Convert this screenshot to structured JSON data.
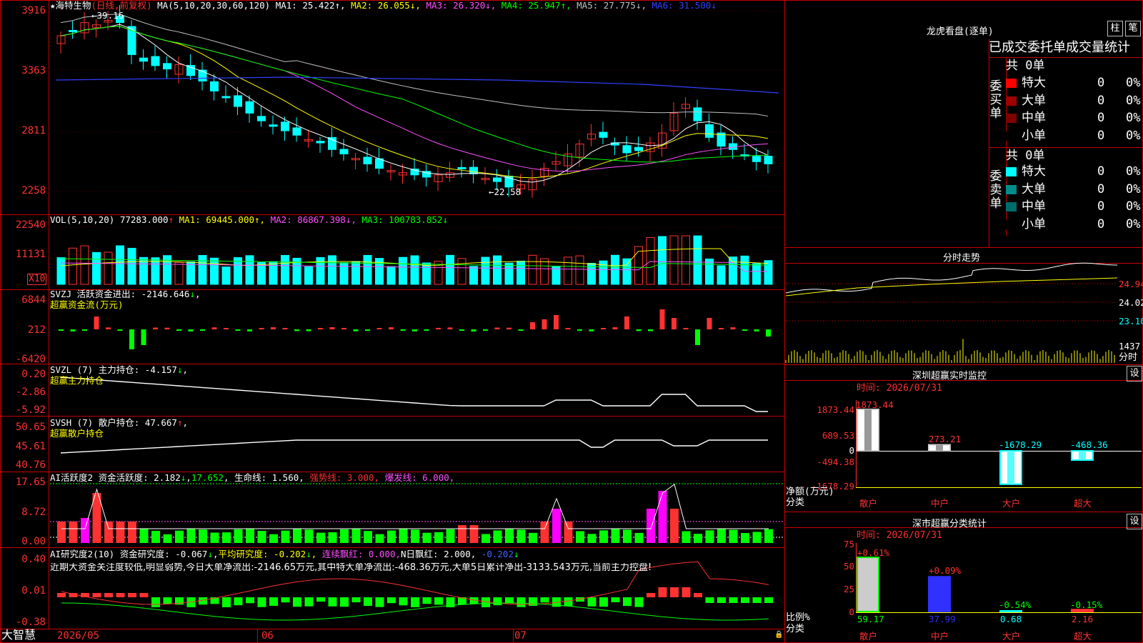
{
  "main": {
    "stock": "★海特生物",
    "period": "(日线,前复权)",
    "ma_label": "MA(5,10,20,30,60,120)",
    "ma": [
      {
        "t": "MA1: 25.422",
        "a": "↑",
        "c": "#ffffff"
      },
      {
        "t": "MA2: 26.055",
        "a": "↓",
        "c": "#ffff00"
      },
      {
        "t": "MA3: 26.320",
        "a": "↓",
        "c": "#ff50ff"
      },
      {
        "t": "MA4: 25.947",
        "a": "↑",
        "c": "#00ff00"
      },
      {
        "t": "MA5: 27.775",
        "a": "↓",
        "c": "#c0c0c0"
      },
      {
        "t": "MA6: 31.500",
        "a": "↓",
        "c": "#3040ff"
      }
    ],
    "axis": [
      "3916",
      "3363",
      "2811",
      "2258"
    ],
    "high_label": "←39.16",
    "low_label": "←22.58"
  },
  "vol": {
    "label": "VOL(5,10,20)",
    "value": "77283.000",
    "ma": [
      {
        "t": "MA1: 69445.000",
        "a": "↑",
        "c": "#ffff00"
      },
      {
        "t": "MA2: 86867.398",
        "a": "↓",
        "c": "#ff50ff"
      },
      {
        "t": "MA3: 100783.852",
        "a": "↓",
        "c": "#00ff00"
      }
    ],
    "axis": [
      "22540",
      "11131"
    ],
    "unit": "X10"
  },
  "svzj": {
    "label": "SVZJ",
    "l1": "活跃资金进出: -2146.646",
    "a1": "↓",
    "l2": "超赢资金流(万元)",
    "axis": [
      "6844",
      "212",
      "-6420"
    ]
  },
  "svzl": {
    "label": "SVZL (7)",
    "l1": "主力持仓: -4.157",
    "a1": "↓",
    "l2": "超赢主力持仓",
    "axis": [
      "0.20",
      "-2.86",
      "-5.92"
    ]
  },
  "svsh": {
    "label": "SVSH (7)",
    "l1": "散户持仓: 47.667",
    "a1": "↑",
    "l2": "超赢散户持仓",
    "axis": [
      "50.65",
      "45.61",
      "40.76"
    ]
  },
  "ai1": {
    "label": "AI活跃度2",
    "p1": "资金活跃度: 2.182",
    "a1": "↓",
    "p2": "17.652",
    "a2": ",",
    "p3": "生命线: 1.560",
    "p4": "强势线: 3.000",
    "p5": "爆发线: 6.000",
    "axis": [
      "17.65",
      "8.72",
      "0.00"
    ]
  },
  "ai2": {
    "label": "AI研究度2(10)",
    "p1": "资金研究度: -0.067",
    "a1": "↓",
    "p2": "平均研究度: -0.202",
    "a2": "↓",
    "p3": "连续飘红: 0.000",
    "p4": "N日飘红: 2.000",
    "p5": "-0.202",
    "a5": "↓",
    "text": "近期大资金关注度较低,明显弱势,今日大单净流出:-2146.65万元,其中特大单净流出:-468.36万元,大单5日累计净出-3133.543万元,当前主力控盘!",
    "axis": [
      "0.40",
      "0.01",
      "-0.38"
    ]
  },
  "bottom": {
    "brand": "大智慧",
    "months": [
      "2026/05",
      "06",
      "07"
    ]
  },
  "dragon": {
    "title": "龙虎看盘(逐单)",
    "btn1": "柱",
    "btn2": "笔",
    "header": "已成交委托单成交量统计",
    "buy": {
      "side": "委买单",
      "total": "共 0单",
      "rows": [
        {
          "label": "特大",
          "v": "0",
          "p": "0%",
          "c": "#ff0000"
        },
        {
          "label": "大单",
          "v": "0",
          "p": "0%",
          "c": "#a00000"
        },
        {
          "label": "中单",
          "v": "0",
          "p": "0%",
          "c": "#800000"
        },
        {
          "label": "小单",
          "v": "0",
          "p": "0%",
          "c": "#000000"
        }
      ]
    },
    "sell": {
      "side": "委卖单",
      "total": "共 0单",
      "rows": [
        {
          "label": "特大",
          "v": "0",
          "p": "0%",
          "c": "#00ffff"
        },
        {
          "label": "大单",
          "v": "0",
          "p": "0%",
          "c": "#008b8b"
        },
        {
          "label": "中单",
          "v": "0",
          "p": "0%",
          "c": "#006b6b"
        },
        {
          "label": "小单",
          "v": "0",
          "p": "0%",
          "c": "#000000"
        }
      ]
    }
  },
  "intraday": {
    "title": "分时走势",
    "axis": [
      "24.94",
      "24.02",
      "23.10"
    ],
    "vol": "1437",
    "vol_unit": "分时"
  },
  "monitor": {
    "title": "深圳超赢实时监控",
    "btn": "设",
    "time": "时间: 2026/07/31",
    "axis": [
      "1873.44",
      "689.53",
      "0",
      "-494.38",
      "-1678.29"
    ],
    "ylabel": "净额(万元)",
    "xlabel": "分类",
    "cats": [
      "散户",
      "中户",
      "大户",
      "超大"
    ],
    "values": [
      1873.44,
      273.21,
      -1678.29,
      -468.36
    ],
    "vlabels": [
      "1873.44",
      "273.21",
      "-1678.29",
      "-468.36"
    ]
  },
  "stats": {
    "title": "深市超赢分类统计",
    "btn": "设",
    "time": "时间: 2026/07/31",
    "axis": [
      "75",
      "50",
      "25",
      "0"
    ],
    "ylabel": "比例%",
    "xlabel": "分类",
    "cats": [
      "散户",
      "中户",
      "大户",
      "超大"
    ],
    "values": [
      59.17,
      37.99,
      0.68,
      2.16
    ],
    "vlabels": [
      "59.17",
      "37.99",
      "0.68",
      "2.16"
    ],
    "deltas": [
      "+0.61%",
      "+0.09%",
      "-0.54%",
      "-0.15%"
    ]
  },
  "colors": {
    "up": "#ff3232",
    "down": "#00ffff",
    "grid": "#b00000",
    "border": "#c80000"
  }
}
